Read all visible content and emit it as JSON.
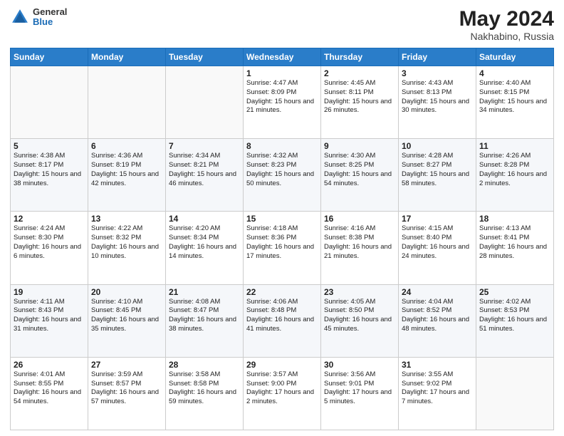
{
  "header": {
    "logo": {
      "general": "General",
      "blue": "Blue"
    },
    "title": "May 2024",
    "location": "Nakhabino, Russia"
  },
  "weekdays": [
    "Sunday",
    "Monday",
    "Tuesday",
    "Wednesday",
    "Thursday",
    "Friday",
    "Saturday"
  ],
  "weeks": [
    [
      {
        "day": "",
        "info": ""
      },
      {
        "day": "",
        "info": ""
      },
      {
        "day": "",
        "info": ""
      },
      {
        "day": "1",
        "info": "Sunrise: 4:47 AM\nSunset: 8:09 PM\nDaylight: 15 hours\nand 21 minutes."
      },
      {
        "day": "2",
        "info": "Sunrise: 4:45 AM\nSunset: 8:11 PM\nDaylight: 15 hours\nand 26 minutes."
      },
      {
        "day": "3",
        "info": "Sunrise: 4:43 AM\nSunset: 8:13 PM\nDaylight: 15 hours\nand 30 minutes."
      },
      {
        "day": "4",
        "info": "Sunrise: 4:40 AM\nSunset: 8:15 PM\nDaylight: 15 hours\nand 34 minutes."
      }
    ],
    [
      {
        "day": "5",
        "info": "Sunrise: 4:38 AM\nSunset: 8:17 PM\nDaylight: 15 hours\nand 38 minutes."
      },
      {
        "day": "6",
        "info": "Sunrise: 4:36 AM\nSunset: 8:19 PM\nDaylight: 15 hours\nand 42 minutes."
      },
      {
        "day": "7",
        "info": "Sunrise: 4:34 AM\nSunset: 8:21 PM\nDaylight: 15 hours\nand 46 minutes."
      },
      {
        "day": "8",
        "info": "Sunrise: 4:32 AM\nSunset: 8:23 PM\nDaylight: 15 hours\nand 50 minutes."
      },
      {
        "day": "9",
        "info": "Sunrise: 4:30 AM\nSunset: 8:25 PM\nDaylight: 15 hours\nand 54 minutes."
      },
      {
        "day": "10",
        "info": "Sunrise: 4:28 AM\nSunset: 8:27 PM\nDaylight: 15 hours\nand 58 minutes."
      },
      {
        "day": "11",
        "info": "Sunrise: 4:26 AM\nSunset: 8:28 PM\nDaylight: 16 hours\nand 2 minutes."
      }
    ],
    [
      {
        "day": "12",
        "info": "Sunrise: 4:24 AM\nSunset: 8:30 PM\nDaylight: 16 hours\nand 6 minutes."
      },
      {
        "day": "13",
        "info": "Sunrise: 4:22 AM\nSunset: 8:32 PM\nDaylight: 16 hours\nand 10 minutes."
      },
      {
        "day": "14",
        "info": "Sunrise: 4:20 AM\nSunset: 8:34 PM\nDaylight: 16 hours\nand 14 minutes."
      },
      {
        "day": "15",
        "info": "Sunrise: 4:18 AM\nSunset: 8:36 PM\nDaylight: 16 hours\nand 17 minutes."
      },
      {
        "day": "16",
        "info": "Sunrise: 4:16 AM\nSunset: 8:38 PM\nDaylight: 16 hours\nand 21 minutes."
      },
      {
        "day": "17",
        "info": "Sunrise: 4:15 AM\nSunset: 8:40 PM\nDaylight: 16 hours\nand 24 minutes."
      },
      {
        "day": "18",
        "info": "Sunrise: 4:13 AM\nSunset: 8:41 PM\nDaylight: 16 hours\nand 28 minutes."
      }
    ],
    [
      {
        "day": "19",
        "info": "Sunrise: 4:11 AM\nSunset: 8:43 PM\nDaylight: 16 hours\nand 31 minutes."
      },
      {
        "day": "20",
        "info": "Sunrise: 4:10 AM\nSunset: 8:45 PM\nDaylight: 16 hours\nand 35 minutes."
      },
      {
        "day": "21",
        "info": "Sunrise: 4:08 AM\nSunset: 8:47 PM\nDaylight: 16 hours\nand 38 minutes."
      },
      {
        "day": "22",
        "info": "Sunrise: 4:06 AM\nSunset: 8:48 PM\nDaylight: 16 hours\nand 41 minutes."
      },
      {
        "day": "23",
        "info": "Sunrise: 4:05 AM\nSunset: 8:50 PM\nDaylight: 16 hours\nand 45 minutes."
      },
      {
        "day": "24",
        "info": "Sunrise: 4:04 AM\nSunset: 8:52 PM\nDaylight: 16 hours\nand 48 minutes."
      },
      {
        "day": "25",
        "info": "Sunrise: 4:02 AM\nSunset: 8:53 PM\nDaylight: 16 hours\nand 51 minutes."
      }
    ],
    [
      {
        "day": "26",
        "info": "Sunrise: 4:01 AM\nSunset: 8:55 PM\nDaylight: 16 hours\nand 54 minutes."
      },
      {
        "day": "27",
        "info": "Sunrise: 3:59 AM\nSunset: 8:57 PM\nDaylight: 16 hours\nand 57 minutes."
      },
      {
        "day": "28",
        "info": "Sunrise: 3:58 AM\nSunset: 8:58 PM\nDaylight: 16 hours\nand 59 minutes."
      },
      {
        "day": "29",
        "info": "Sunrise: 3:57 AM\nSunset: 9:00 PM\nDaylight: 17 hours\nand 2 minutes."
      },
      {
        "day": "30",
        "info": "Sunrise: 3:56 AM\nSunset: 9:01 PM\nDaylight: 17 hours\nand 5 minutes."
      },
      {
        "day": "31",
        "info": "Sunrise: 3:55 AM\nSunset: 9:02 PM\nDaylight: 17 hours\nand 7 minutes."
      },
      {
        "day": "",
        "info": ""
      }
    ]
  ]
}
